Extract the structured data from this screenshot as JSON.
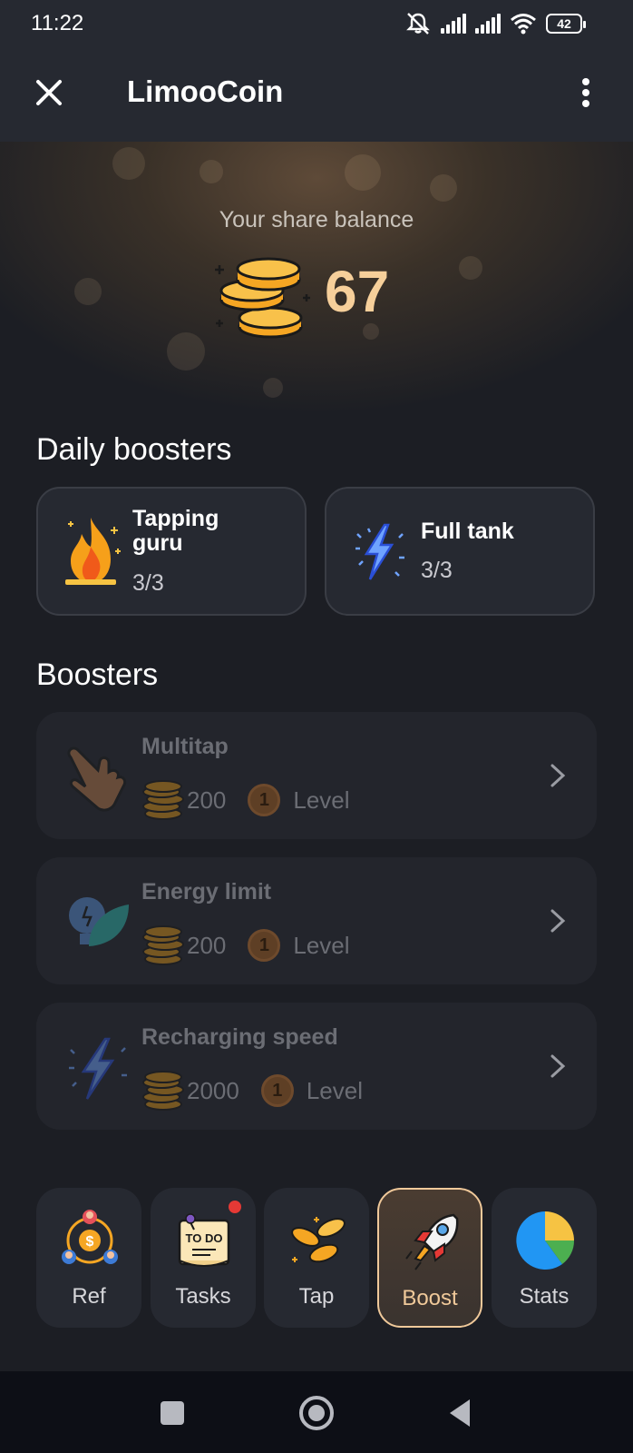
{
  "status_bar": {
    "time": "11:22",
    "battery": "42"
  },
  "header": {
    "title": "LimooCoin"
  },
  "balance": {
    "label": "Your share balance",
    "value": "67"
  },
  "daily_boosters": {
    "title": "Daily boosters",
    "items": [
      {
        "name_line1": "Tapping",
        "name_line2": "guru",
        "count": "3/3",
        "icon": "fire-icon"
      },
      {
        "name": "Full tank",
        "count": "3/3",
        "icon": "lightning-icon"
      }
    ]
  },
  "boosters": {
    "title": "Boosters",
    "items": [
      {
        "name": "Multitap",
        "cost": "200",
        "level_num": "1",
        "level_label": "Level",
        "icon": "tap-hand-icon"
      },
      {
        "name": "Energy limit",
        "cost": "200",
        "level_num": "1",
        "level_label": "Level",
        "icon": "bulb-leaf-icon"
      },
      {
        "name": "Recharging speed",
        "cost": "2000",
        "level_num": "1",
        "level_label": "Level",
        "icon": "lightning-icon"
      }
    ]
  },
  "nav": {
    "items": [
      {
        "label": "Ref"
      },
      {
        "label": "Tasks",
        "badge": true
      },
      {
        "label": "Tap"
      },
      {
        "label": "Boost",
        "active": true
      },
      {
        "label": "Stats"
      }
    ],
    "todo_text": "TO DO"
  },
  "colors": {
    "accent": "#f0c99a",
    "background": "#1c1e24",
    "card": "#262931",
    "badge": "#e53935"
  }
}
